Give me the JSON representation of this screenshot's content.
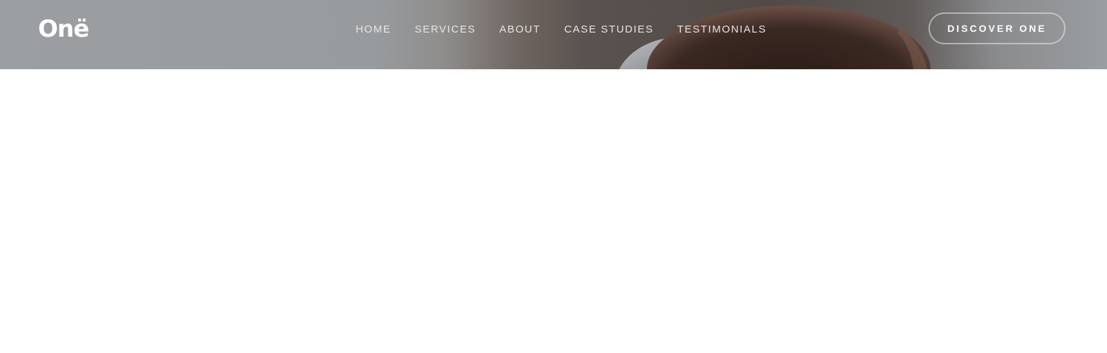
{
  "header": {
    "logo_text": "Onë",
    "nav": [
      {
        "label": "HOME"
      },
      {
        "label": "SERVICES"
      },
      {
        "label": "ABOUT"
      },
      {
        "label": "CASE STUDIES"
      },
      {
        "label": "TESTIMONIALS"
      }
    ],
    "cta_label": "DISCOVER ONE"
  },
  "colors": {
    "header_overlay": "#9b9fa2",
    "nav_text": "#e8e6e4",
    "cta_border": "#ebebeb",
    "page_background": "#ffffff"
  }
}
